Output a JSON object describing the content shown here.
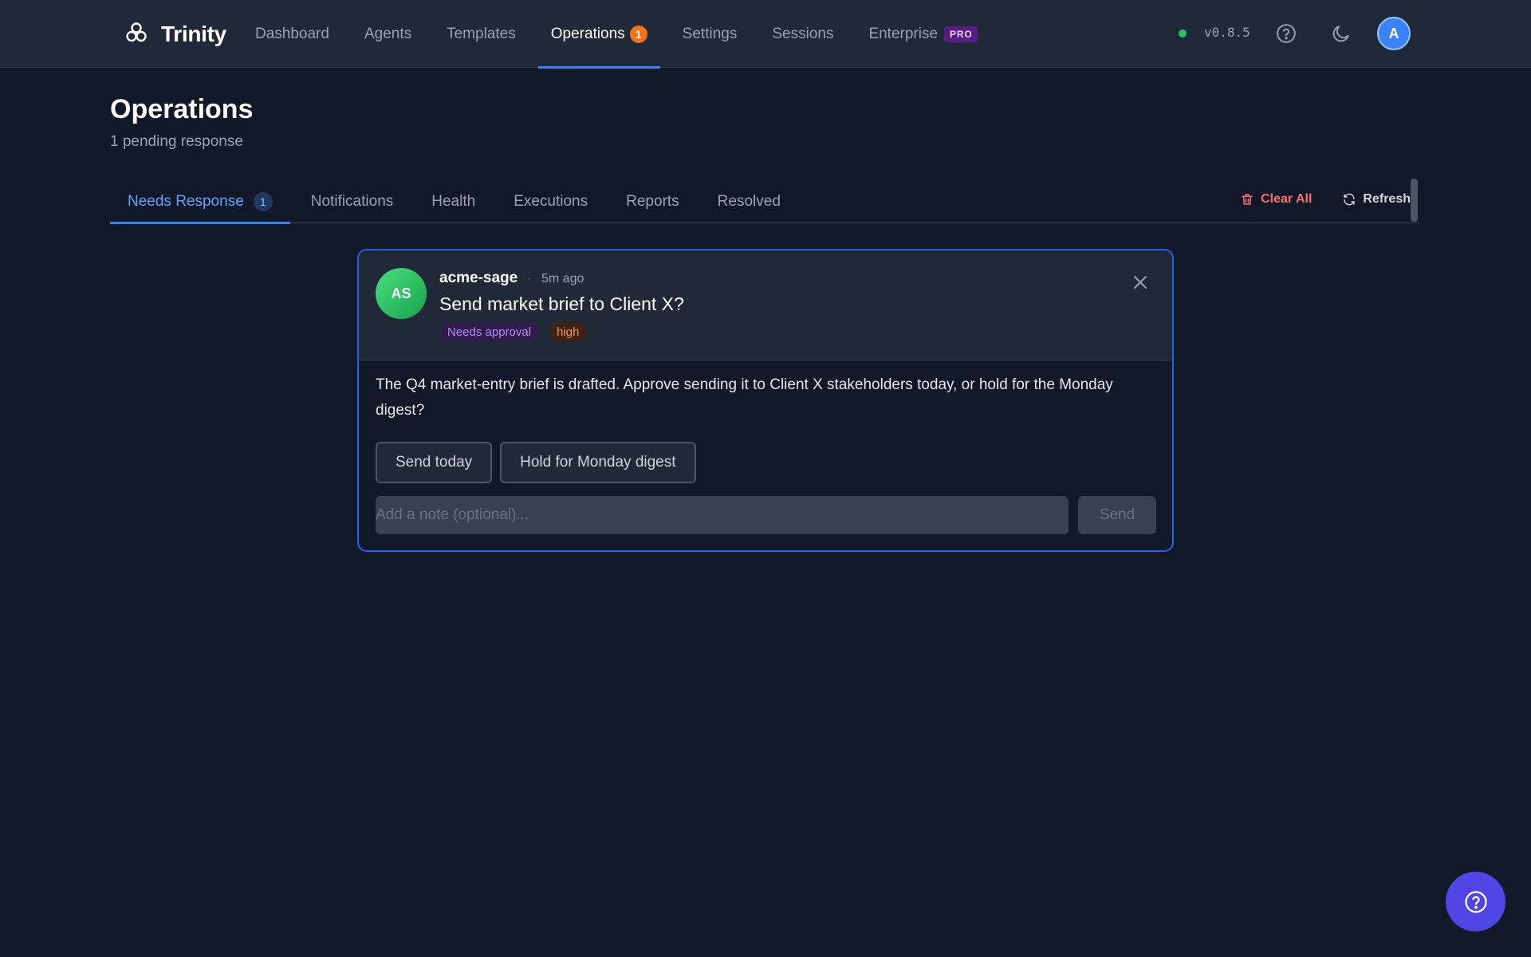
{
  "app": {
    "name": "Trinity",
    "version": "v0.8.5"
  },
  "nav": {
    "items": [
      {
        "label": "Dashboard"
      },
      {
        "label": "Agents"
      },
      {
        "label": "Templates"
      },
      {
        "label": "Operations",
        "badge": "1",
        "active": true
      },
      {
        "label": "Settings"
      },
      {
        "label": "Sessions"
      },
      {
        "label": "Enterprise",
        "tag": "PRO"
      }
    ]
  },
  "user": {
    "initial": "A"
  },
  "page": {
    "title": "Operations",
    "subtitle": "1 pending response"
  },
  "tabs": [
    {
      "label": "Needs Response",
      "count": "1",
      "active": true
    },
    {
      "label": "Notifications"
    },
    {
      "label": "Health"
    },
    {
      "label": "Executions"
    },
    {
      "label": "Reports"
    },
    {
      "label": "Resolved"
    }
  ],
  "actions": {
    "clear_all": "Clear All",
    "refresh": "Refresh"
  },
  "card": {
    "avatar_initials": "AS",
    "agent": "acme-sage",
    "separator": "·",
    "time": "5m ago",
    "question": "Send market brief to Client X?",
    "chips": {
      "type": "Needs approval",
      "priority": "high"
    },
    "body": "The Q4 market-entry brief is drafted. Approve sending it to Client X stakeholders today, or hold for the Monday digest?",
    "options": [
      "Send today",
      "Hold for Monday digest"
    ],
    "note_placeholder": "Add a note (optional)...",
    "send_label": "Send"
  },
  "colors": {
    "background": "#111827",
    "surface": "#1f2937",
    "accent": "#3b82f6",
    "badge_orange": "#f97316",
    "danger": "#f87171",
    "fab": "#4f46e5"
  }
}
